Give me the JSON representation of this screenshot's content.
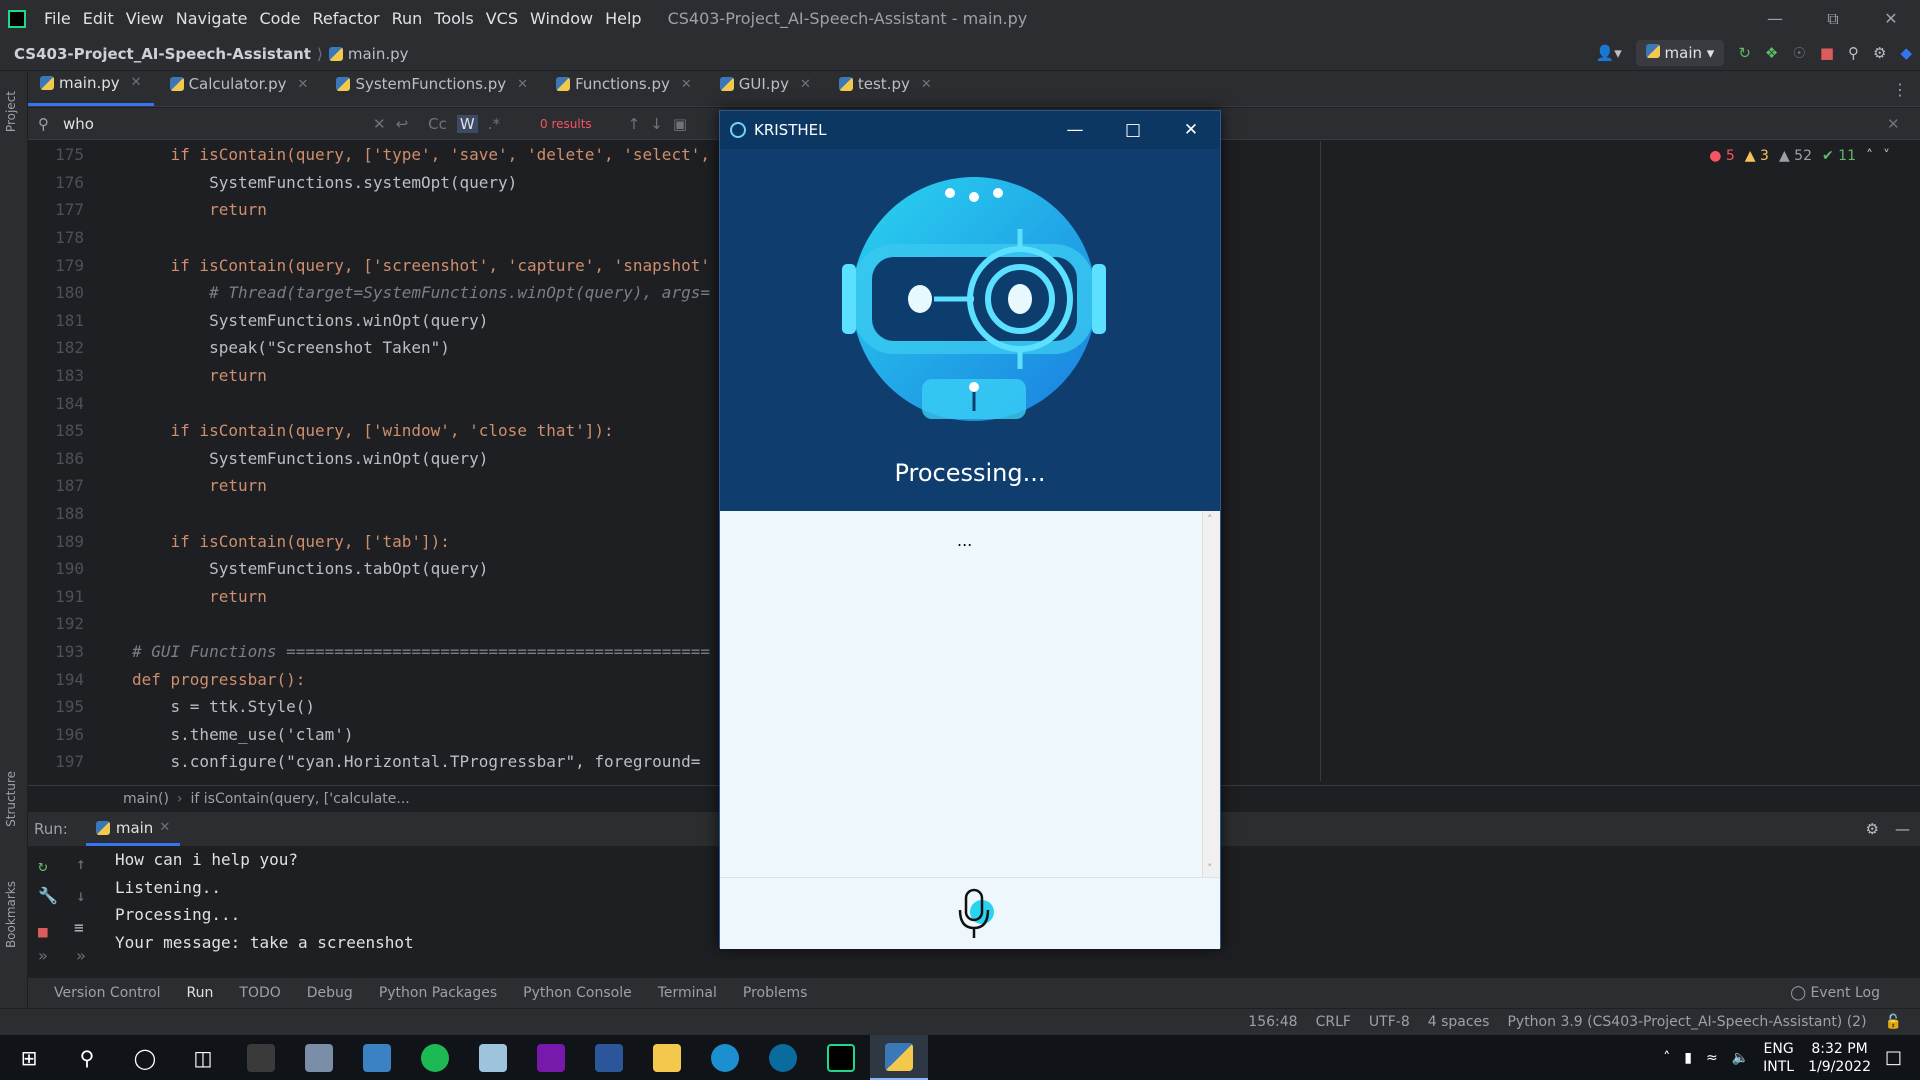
{
  "ide": {
    "menu": [
      "File",
      "Edit",
      "View",
      "Navigate",
      "Code",
      "Refactor",
      "Run",
      "Tools",
      "VCS",
      "Window",
      "Help"
    ],
    "title": "CS403-Project_AI-Speech-Assistant - main.py",
    "project": "CS403-Project_AI-Speech-Assistant",
    "file": "main.py",
    "branch": "main",
    "tabs": [
      "main.py",
      "Calculator.py",
      "SystemFunctions.py",
      "Functions.py",
      "GUI.py",
      "test.py"
    ],
    "search": {
      "query": "who",
      "case": "Cc",
      "word": "W",
      "regex": ".*",
      "results": "0 results"
    },
    "inspections": {
      "errors": "5",
      "warnings": "3",
      "weak": "52",
      "ok": "11"
    },
    "breadcrumb": {
      "fn": "main()",
      "cond": "if isContain(query, ['calculate..."
    },
    "side_labels": {
      "project": "Project",
      "structure": "Structure",
      "bookmarks": "Bookmarks"
    }
  },
  "code": {
    "lines": [
      {
        "n": "175",
        "t": "    if isContain(query, ['type', 'save', 'delete', 'select',"
      },
      {
        "n": "176",
        "t": "        SystemFunctions.systemOpt(query)"
      },
      {
        "n": "177",
        "t": "        return"
      },
      {
        "n": "178",
        "t": ""
      },
      {
        "n": "179",
        "t": "    if isContain(query, ['screenshot', 'capture', 'snapshot'"
      },
      {
        "n": "180",
        "t": "        # Thread(target=SystemFunctions.winOpt(query), args="
      },
      {
        "n": "181",
        "t": "        SystemFunctions.winOpt(query)"
      },
      {
        "n": "182",
        "t": "        speak(\"Screenshot Taken\")"
      },
      {
        "n": "183",
        "t": "        return"
      },
      {
        "n": "184",
        "t": ""
      },
      {
        "n": "185",
        "t": "    if isContain(query, ['window', 'close that']):"
      },
      {
        "n": "186",
        "t": "        SystemFunctions.winOpt(query)"
      },
      {
        "n": "187",
        "t": "        return"
      },
      {
        "n": "188",
        "t": ""
      },
      {
        "n": "189",
        "t": "    if isContain(query, ['tab']):"
      },
      {
        "n": "190",
        "t": "        SystemFunctions.tabOpt(query)"
      },
      {
        "n": "191",
        "t": "        return"
      },
      {
        "n": "192",
        "t": ""
      },
      {
        "n": "193",
        "t": "# GUI Functions ============================================"
      },
      {
        "n": "194",
        "t": "def progressbar():"
      },
      {
        "n": "195",
        "t": "    s = ttk.Style()"
      },
      {
        "n": "196",
        "t": "    s.theme_use('clam')"
      },
      {
        "n": "197",
        "t": "    s.configure(\"cyan.Horizontal.TProgressbar\", foreground="
      }
    ]
  },
  "run": {
    "label": "Run:",
    "tab": "main",
    "output": [
      "How can i help you?",
      "Listening..",
      "Processing...",
      "Your message: take a screenshot"
    ]
  },
  "bottom_tabs": [
    "Version Control",
    "Run",
    "TODO",
    "Debug",
    "Python Packages",
    "Python Console",
    "Terminal",
    "Problems"
  ],
  "event_log": "Event Log",
  "statusbar": {
    "pos": "156:48",
    "eol": "CRLF",
    "enc": "UTF-8",
    "indent": "4 spaces",
    "interp": "Python 3.9 (CS403-Project_AI-Speech-Assistant) (2)"
  },
  "app": {
    "title": "KRISTHEL",
    "status": "Processing...",
    "chat_text": "...",
    "accent": "#2ad4f0"
  },
  "taskbar": {
    "lang": "ENG",
    "layout": "INTL",
    "time": "8:32 PM",
    "date": "1/9/2022"
  }
}
